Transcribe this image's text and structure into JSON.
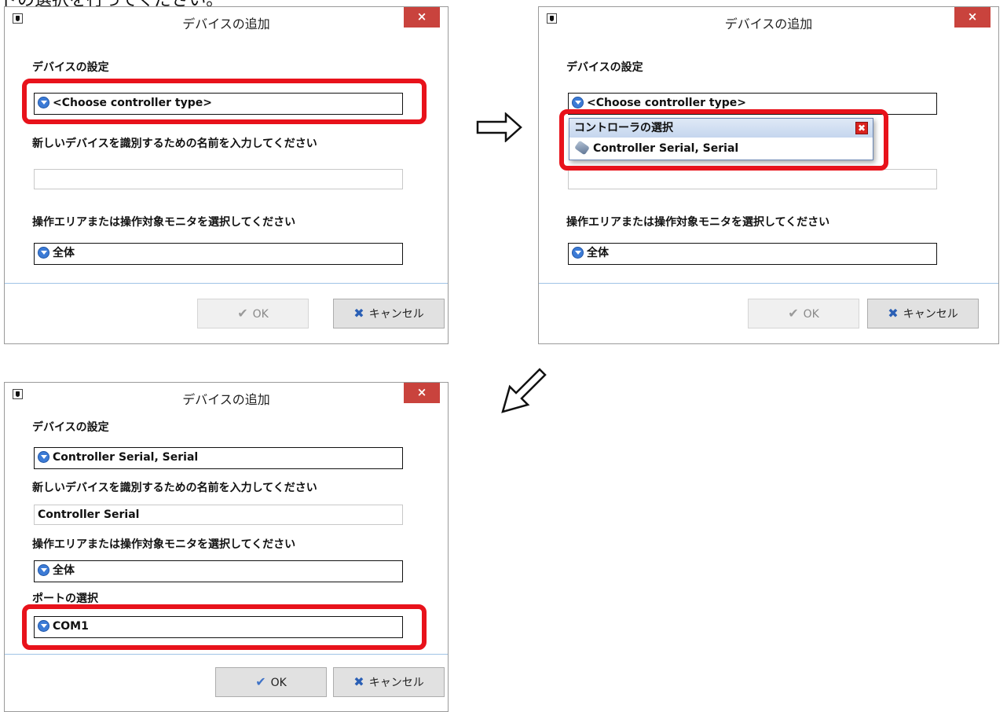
{
  "intro_text": "ドの選択を行ってください。",
  "dialog": {
    "title": "デバイスの追加",
    "close_glyph": "×",
    "device_settings_label": "デバイスの設定",
    "name_prompt": "新しいデバイスを識別するための名前を入力してください",
    "area_prompt": "操作エリアまたは操作対象モニタを選択してください",
    "area_value": "全体",
    "port_label": "ポートの選択",
    "port_value": "COM1",
    "ok_label": "OK",
    "cancel_label": "キャンセル"
  },
  "step1": {
    "controller_value": "<Choose controller type>",
    "name_value": ""
  },
  "step2": {
    "controller_value": "<Choose controller type>",
    "popup_title": "コントローラの選択",
    "popup_item": "Controller Serial, Serial"
  },
  "step3": {
    "controller_value": "Controller Serial, Serial",
    "name_value": "Controller Serial"
  },
  "colors": {
    "highlight": "#e8121b",
    "close_button": "#c9433d",
    "separator": "#9fc3e6",
    "combo_icon": "#3c7bd6"
  }
}
